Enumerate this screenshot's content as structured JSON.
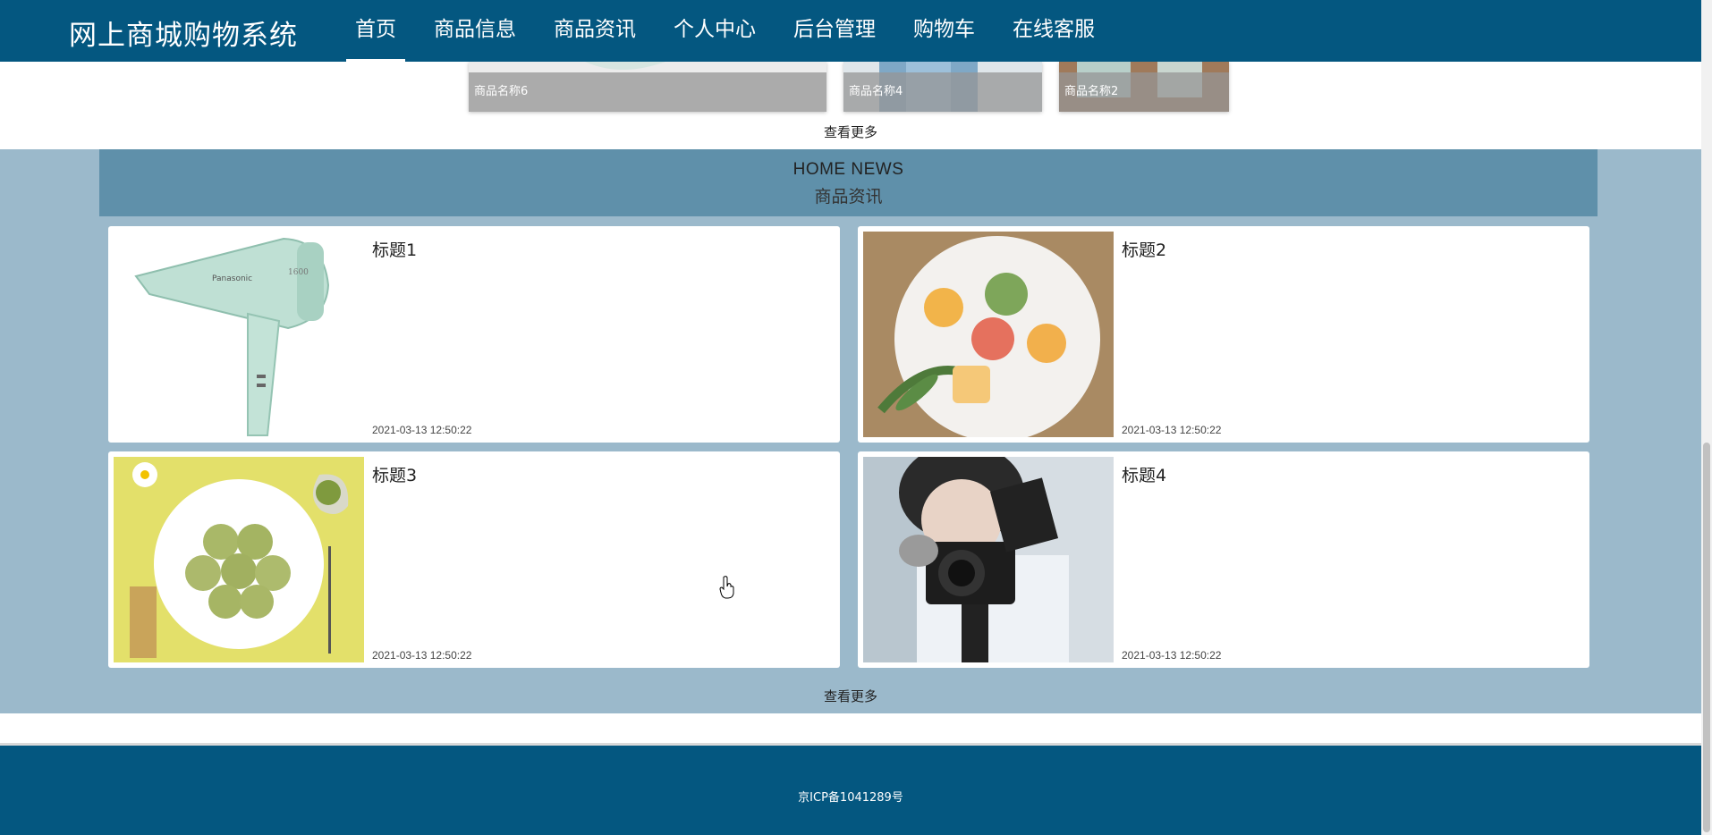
{
  "header": {
    "brand": "网上商城购物系统",
    "nav": [
      {
        "label": "首页",
        "active": true
      },
      {
        "label": "商品信息",
        "active": false
      },
      {
        "label": "商品资讯",
        "active": false
      },
      {
        "label": "个人中心",
        "active": false
      },
      {
        "label": "后台管理",
        "active": false
      },
      {
        "label": "购物车",
        "active": false
      },
      {
        "label": "在线客服",
        "active": false
      }
    ]
  },
  "products": {
    "items": [
      {
        "name": "商品名称6"
      },
      {
        "name": "商品名称4"
      },
      {
        "name": "商品名称2"
      }
    ],
    "more_label": "查看更多"
  },
  "news": {
    "heading_en": "HOME NEWS",
    "heading_cn": "商品资讯",
    "items": [
      {
        "title": "标题1",
        "time": "2021-03-13 12:50:22",
        "image": "hair-dryer"
      },
      {
        "title": "标题2",
        "time": "2021-03-13 12:50:22",
        "image": "mooncakes"
      },
      {
        "title": "标题3",
        "time": "2021-03-13 12:50:22",
        "image": "matcha-cookies"
      },
      {
        "title": "标题4",
        "time": "2021-03-13 12:50:22",
        "image": "vlog-camera"
      }
    ],
    "more_label": "查看更多"
  },
  "footer": {
    "icp": "京ICP备1041289号"
  },
  "colors": {
    "nav_bg": "#045780",
    "section_bg": "#9bb9cb",
    "header_band": "#5f90aa"
  }
}
